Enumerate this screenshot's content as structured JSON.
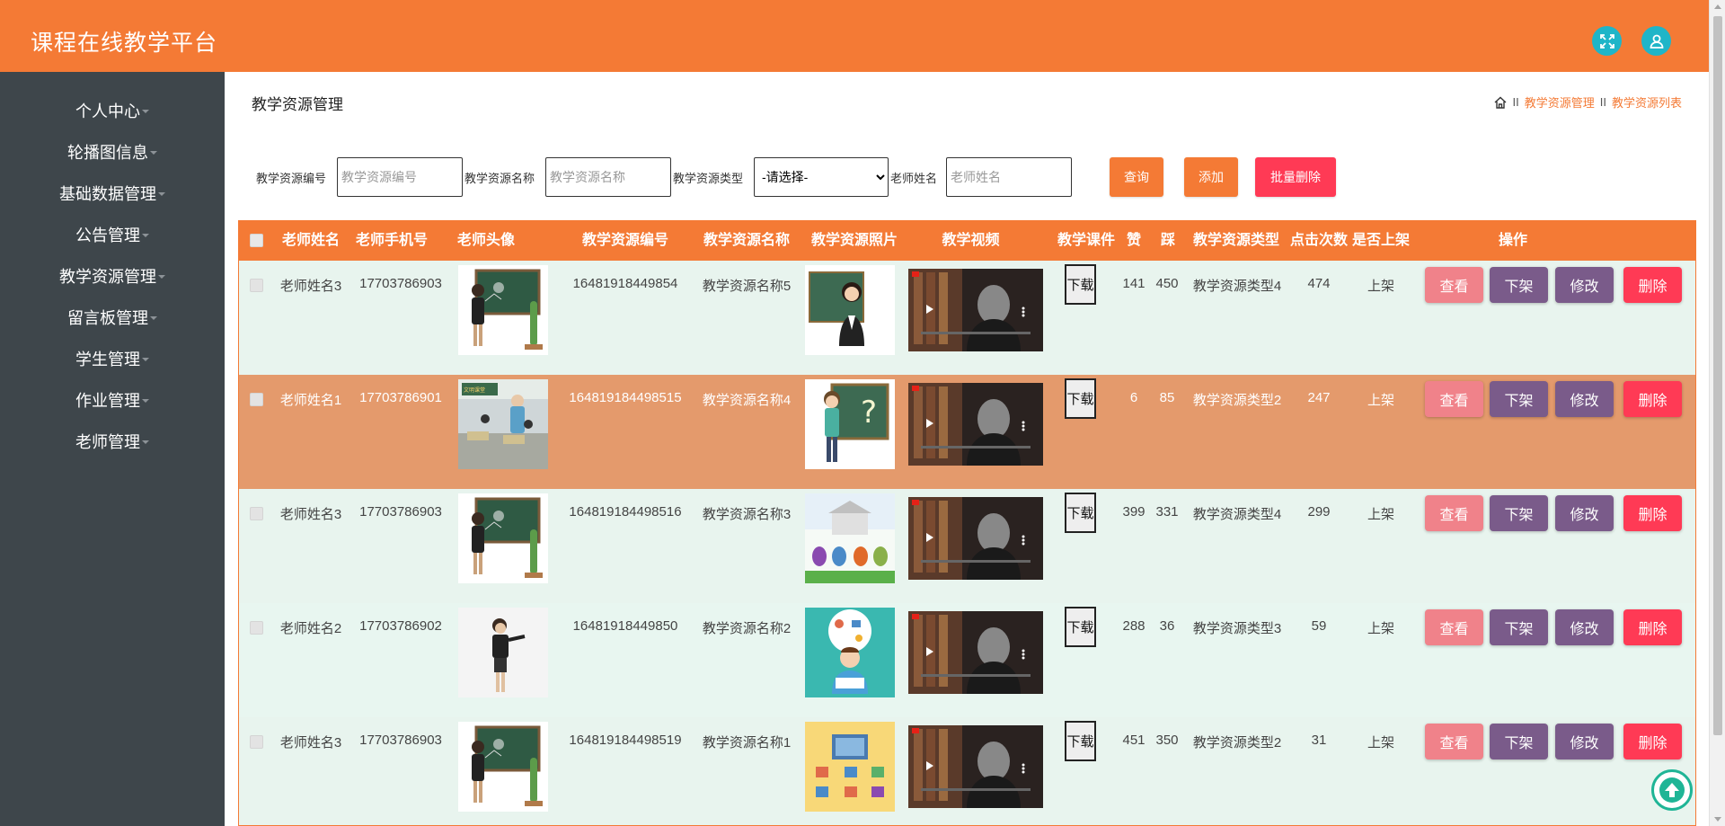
{
  "app": {
    "title": "课程在线教学平台"
  },
  "colors": {
    "header": "#f47a35",
    "sidebar": "#3e464b",
    "accent_icon": "#1fb5c8",
    "row_light": "#e8f4ee",
    "row_highlight": "#e49a6c",
    "btn_view": "#f0828a",
    "btn_shelf": "#7a5b8a",
    "btn_edit": "#7a5b8a",
    "btn_delete": "#ff3a55"
  },
  "header": {
    "fullscreen_icon": "expand-icon",
    "user_icon": "user-icon"
  },
  "sidebar": {
    "items": [
      {
        "label": "个人中心"
      },
      {
        "label": "轮播图信息"
      },
      {
        "label": "基础数据管理"
      },
      {
        "label": "公告管理"
      },
      {
        "label": "教学资源管理"
      },
      {
        "label": "留言板管理"
      },
      {
        "label": "学生管理"
      },
      {
        "label": "作业管理"
      },
      {
        "label": "老师管理"
      }
    ]
  },
  "page": {
    "title": "教学资源管理",
    "breadcrumb": {
      "sep": "II",
      "level1": "教学资源管理",
      "level2": "教学资源列表"
    }
  },
  "search": {
    "code_label": "教学资源编号",
    "code_placeholder": "教学资源编号",
    "name_label": "教学资源名称",
    "name_placeholder": "教学资源名称",
    "type_label": "教学资源类型",
    "type_selected": "-请选择-",
    "teacher_label": "老师姓名",
    "teacher_placeholder": "老师姓名",
    "query_button": "查询",
    "add_button": "添加",
    "batch_delete_button": "批量删除"
  },
  "table": {
    "headers": [
      "老师姓名",
      "老师手机号",
      "老师头像",
      "教学资源编号",
      "教学资源名称",
      "教学资源照片",
      "教学视频",
      "教学课件",
      "赞",
      "踩",
      "教学资源类型",
      "点击次数",
      "是否上架",
      "操作"
    ],
    "actions": {
      "view": "查看",
      "unshelf": "下架",
      "edit": "修改",
      "delete": "删除"
    },
    "download_label": "下载",
    "rows": [
      {
        "teacher": "老师姓名3",
        "phone": "17703786903",
        "code": "16481918449854",
        "name": "教学资源名称5",
        "likes": "141",
        "dislikes": "450",
        "type": "教学资源类型4",
        "clicks": "474",
        "status": "上架"
      },
      {
        "teacher": "老师姓名1",
        "phone": "17703786901",
        "code": "164819184498515",
        "name": "教学资源名称4",
        "likes": "6",
        "dislikes": "85",
        "type": "教学资源类型2",
        "clicks": "247",
        "status": "上架"
      },
      {
        "teacher": "老师姓名3",
        "phone": "17703786903",
        "code": "164819184498516",
        "name": "教学资源名称3",
        "likes": "399",
        "dislikes": "331",
        "type": "教学资源类型4",
        "clicks": "299",
        "status": "上架"
      },
      {
        "teacher": "老师姓名2",
        "phone": "17703786902",
        "code": "16481918449850",
        "name": "教学资源名称2",
        "likes": "288",
        "dislikes": "36",
        "type": "教学资源类型3",
        "clicks": "59",
        "status": "上架"
      },
      {
        "teacher": "老师姓名3",
        "phone": "17703786903",
        "code": "164819184498519",
        "name": "教学资源名称1",
        "likes": "451",
        "dislikes": "350",
        "type": "教学资源类型2",
        "clicks": "31",
        "status": "上架"
      }
    ]
  }
}
